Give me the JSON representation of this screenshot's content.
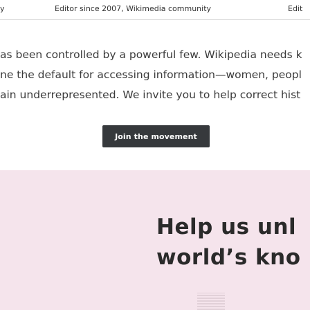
{
  "header": {
    "left_fragment": "y",
    "byline": "Editor since 2007, Wikimedia community",
    "edit_label": "Edit"
  },
  "article": {
    "line1": "as been controlled by a powerful few. Wikipedia needs k",
    "line2": "ne the default for accessing information—women, peopl",
    "line3": "ain underrepresented. We invite you to help correct hist"
  },
  "cta": {
    "label": "Join the movement"
  },
  "hero": {
    "title_line1": "Help us unl",
    "title_line2": "world’s kno",
    "background_color": "#f5e4ec"
  }
}
